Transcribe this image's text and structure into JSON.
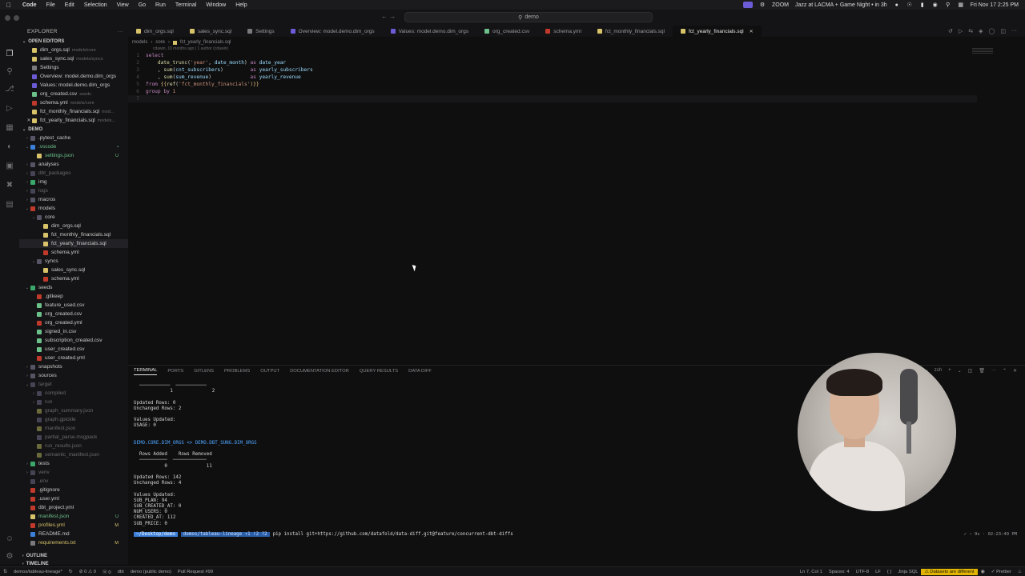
{
  "menubar": {
    "items": [
      "Code",
      "File",
      "Edit",
      "Selection",
      "View",
      "Go",
      "Run",
      "Terminal",
      "Window",
      "Help"
    ],
    "zoom_label": "ZOOM",
    "event": "Jazz at LACMA + Game Night • in 3h",
    "datetime": "Fri Nov 17  2:25 PM"
  },
  "titlebar": {
    "command_center": "demo"
  },
  "sidebar": {
    "title": "EXPLORER",
    "open_editors_label": "OPEN EDITORS",
    "open_editors": [
      {
        "name": "dim_orgs.sql",
        "desc": "models/core",
        "color": "#d8c36a"
      },
      {
        "name": "sales_sync.sql",
        "desc": "models/syncs",
        "color": "#d8c36a"
      },
      {
        "name": "Settings",
        "desc": "",
        "color": "#7a7a7e"
      },
      {
        "name": "Overview: model.demo.dim_orgs",
        "desc": "",
        "color": "#6b5bd6"
      },
      {
        "name": "Values: model.demo.dim_orgs",
        "desc": "",
        "color": "#6b5bd6"
      },
      {
        "name": "org_created.csv",
        "desc": "seeds",
        "color": "#6cc08a"
      },
      {
        "name": "schema.yml",
        "desc": "models/core",
        "color": "#c0392b"
      },
      {
        "name": "fct_monthly_financials.sql",
        "desc": "mod...",
        "color": "#d8c36a"
      },
      {
        "name": "fct_yearly_financials.sql",
        "desc": "models...",
        "color": "#d8c36a"
      }
    ],
    "project_label": "DEMO",
    "tree": [
      {
        "depth": 0,
        "chev": "›",
        "name": ".pytest_cache",
        "cls": "",
        "icon": "#556",
        "badge": ""
      },
      {
        "depth": 0,
        "chev": "⌄",
        "name": ".vscode",
        "cls": "c-green",
        "icon": "#3b7fd9",
        "badge": "•"
      },
      {
        "depth": 1,
        "chev": "",
        "name": "settings.json",
        "cls": "c-green",
        "icon": "#d8c36a",
        "badge": "U"
      },
      {
        "depth": 0,
        "chev": "›",
        "name": "analyses",
        "cls": "",
        "icon": "#556",
        "badge": ""
      },
      {
        "depth": 0,
        "chev": "›",
        "name": "dbt_packages",
        "cls": "c-dim",
        "icon": "#445",
        "badge": ""
      },
      {
        "depth": 0,
        "chev": "›",
        "name": "img",
        "cls": "",
        "icon": "#3aa86b",
        "badge": ""
      },
      {
        "depth": 0,
        "chev": "›",
        "name": "logs",
        "cls": "c-dim",
        "icon": "#445",
        "badge": ""
      },
      {
        "depth": 0,
        "chev": "›",
        "name": "macros",
        "cls": "",
        "icon": "#556",
        "badge": ""
      },
      {
        "depth": 0,
        "chev": "⌄",
        "name": "models",
        "cls": "",
        "icon": "#c0392b",
        "badge": ""
      },
      {
        "depth": 1,
        "chev": "⌄",
        "name": "core",
        "cls": "",
        "icon": "#556",
        "badge": ""
      },
      {
        "depth": 2,
        "chev": "",
        "name": "dim_orgs.sql",
        "cls": "",
        "icon": "#d8c36a",
        "badge": ""
      },
      {
        "depth": 2,
        "chev": "",
        "name": "fct_monthly_financials.sql",
        "cls": "",
        "icon": "#d8c36a",
        "badge": ""
      },
      {
        "depth": 2,
        "chev": "",
        "name": "fct_yearly_financials.sql",
        "cls": "",
        "icon": "#d8c36a",
        "badge": "",
        "sel": true
      },
      {
        "depth": 2,
        "chev": "",
        "name": "schema.yml",
        "cls": "",
        "icon": "#c0392b",
        "badge": ""
      },
      {
        "depth": 1,
        "chev": "⌄",
        "name": "syncs",
        "cls": "",
        "icon": "#556",
        "badge": ""
      },
      {
        "depth": 2,
        "chev": "",
        "name": "sales_sync.sql",
        "cls": "",
        "icon": "#d8c36a",
        "badge": ""
      },
      {
        "depth": 2,
        "chev": "",
        "name": "schema.yml",
        "cls": "",
        "icon": "#c0392b",
        "badge": ""
      },
      {
        "depth": 0,
        "chev": "⌄",
        "name": "seeds",
        "cls": "",
        "icon": "#3aa86b",
        "badge": ""
      },
      {
        "depth": 1,
        "chev": "",
        "name": ".gitkeep",
        "cls": "",
        "icon": "#c0392b",
        "badge": ""
      },
      {
        "depth": 1,
        "chev": "",
        "name": "feature_used.csv",
        "cls": "",
        "icon": "#6cc08a",
        "badge": ""
      },
      {
        "depth": 1,
        "chev": "",
        "name": "org_created.csv",
        "cls": "",
        "icon": "#6cc08a",
        "badge": ""
      },
      {
        "depth": 1,
        "chev": "",
        "name": "org_created.yml",
        "cls": "",
        "icon": "#c0392b",
        "badge": ""
      },
      {
        "depth": 1,
        "chev": "",
        "name": "signed_in.csv",
        "cls": "",
        "icon": "#6cc08a",
        "badge": ""
      },
      {
        "depth": 1,
        "chev": "",
        "name": "subscription_created.csv",
        "cls": "",
        "icon": "#6cc08a",
        "badge": ""
      },
      {
        "depth": 1,
        "chev": "",
        "name": "user_created.csv",
        "cls": "",
        "icon": "#6cc08a",
        "badge": ""
      },
      {
        "depth": 1,
        "chev": "",
        "name": "user_created.yml",
        "cls": "",
        "icon": "#c0392b",
        "badge": ""
      },
      {
        "depth": 0,
        "chev": "›",
        "name": "snapshots",
        "cls": "",
        "icon": "#556",
        "badge": ""
      },
      {
        "depth": 0,
        "chev": "›",
        "name": "sources",
        "cls": "",
        "icon": "#556",
        "badge": ""
      },
      {
        "depth": 0,
        "chev": "⌄",
        "name": "target",
        "cls": "c-dim",
        "icon": "#445",
        "badge": ""
      },
      {
        "depth": 1,
        "chev": "›",
        "name": "compiled",
        "cls": "c-dim",
        "icon": "#445",
        "badge": ""
      },
      {
        "depth": 1,
        "chev": "›",
        "name": "run",
        "cls": "c-dim",
        "icon": "#445",
        "badge": ""
      },
      {
        "depth": 1,
        "chev": "",
        "name": "graph_summary.json",
        "cls": "c-dim",
        "icon": "#6a6a3a",
        "badge": ""
      },
      {
        "depth": 1,
        "chev": "",
        "name": "graph.gpickle",
        "cls": "c-dim",
        "icon": "#445",
        "badge": ""
      },
      {
        "depth": 1,
        "chev": "",
        "name": "manifest.json",
        "cls": "c-dim",
        "icon": "#6a6a3a",
        "badge": ""
      },
      {
        "depth": 1,
        "chev": "",
        "name": "partial_parse.msgpack",
        "cls": "c-dim",
        "icon": "#445",
        "badge": ""
      },
      {
        "depth": 1,
        "chev": "",
        "name": "run_results.json",
        "cls": "c-dim",
        "icon": "#6a6a3a",
        "badge": ""
      },
      {
        "depth": 1,
        "chev": "",
        "name": "semantic_manifest.json",
        "cls": "c-dim",
        "icon": "#6a6a3a",
        "badge": ""
      },
      {
        "depth": 0,
        "chev": "›",
        "name": "tests",
        "cls": "",
        "icon": "#3aa86b",
        "badge": ""
      },
      {
        "depth": 0,
        "chev": "›",
        "name": "venv",
        "cls": "c-dim",
        "icon": "#445",
        "badge": ""
      },
      {
        "depth": 0,
        "chev": "",
        "name": ".env",
        "cls": "c-dim",
        "icon": "#445",
        "badge": ""
      },
      {
        "depth": 0,
        "chev": "",
        "name": ".gitignore",
        "cls": "",
        "icon": "#c0392b",
        "badge": ""
      },
      {
        "depth": 0,
        "chev": "",
        "name": ".user.yml",
        "cls": "",
        "icon": "#c0392b",
        "badge": ""
      },
      {
        "depth": 0,
        "chev": "",
        "name": "dbt_project.yml",
        "cls": "",
        "icon": "#c0392b",
        "badge": ""
      },
      {
        "depth": 0,
        "chev": "",
        "name": "manifest.json",
        "cls": "c-green",
        "icon": "#d8c36a",
        "badge": "U"
      },
      {
        "depth": 0,
        "chev": "",
        "name": "profiles.yml",
        "cls": "c-yellow",
        "icon": "#c0392b",
        "badge": "M"
      },
      {
        "depth": 0,
        "chev": "",
        "name": "README.md",
        "cls": "",
        "icon": "#3b7fd9",
        "badge": ""
      },
      {
        "depth": 0,
        "chev": "",
        "name": "requirements.txt",
        "cls": "c-yellow",
        "icon": "#7a7a7e",
        "badge": "M"
      }
    ],
    "outline_label": "OUTLINE",
    "timeline_label": "TIMELINE"
  },
  "tabs": [
    {
      "label": "dim_orgs.sql",
      "color": "#d8c36a",
      "active": false
    },
    {
      "label": "sales_sync.sql",
      "color": "#d8c36a",
      "active": false
    },
    {
      "label": "Settings",
      "color": "#7a7a7e",
      "active": false
    },
    {
      "label": "Overview: model.demo.dim_orgs",
      "color": "#6b5bd6",
      "active": false
    },
    {
      "label": "Values: model.demo.dim_orgs",
      "color": "#6b5bd6",
      "active": false
    },
    {
      "label": "org_created.csv",
      "color": "#6cc08a",
      "active": false
    },
    {
      "label": "schema.yml",
      "color": "#c0392b",
      "active": false
    },
    {
      "label": "fct_monthly_financials.sql",
      "color": "#d8c36a",
      "active": false
    },
    {
      "label": "fct_yearly_financials.sql",
      "color": "#d8c36a",
      "active": true
    }
  ],
  "breadcrumb": [
    "models",
    "core",
    "fct_yearly_financials.sql"
  ],
  "blame": "cdawin, 10 months ago | 1 author (cdawin)",
  "code_lines": [
    [
      {
        "t": "select",
        "c": "kw"
      }
    ],
    [
      {
        "t": "    ",
        "c": "pl"
      },
      {
        "t": "date_trunc",
        "c": "fn"
      },
      {
        "t": "(",
        "c": "pl"
      },
      {
        "t": "'year'",
        "c": "str"
      },
      {
        "t": ", ",
        "c": "pl"
      },
      {
        "t": "date_month",
        "c": "id"
      },
      {
        "t": ") ",
        "c": "pl"
      },
      {
        "t": "as",
        "c": "kw"
      },
      {
        "t": " date_year",
        "c": "id"
      }
    ],
    [
      {
        "t": "    , ",
        "c": "pl"
      },
      {
        "t": "sum",
        "c": "fn"
      },
      {
        "t": "(",
        "c": "pl"
      },
      {
        "t": "cnt_subscribers",
        "c": "id"
      },
      {
        "t": ")         ",
        "c": "pl"
      },
      {
        "t": "as",
        "c": "kw"
      },
      {
        "t": " yearly_subscribers",
        "c": "id"
      }
    ],
    [
      {
        "t": "    , ",
        "c": "pl"
      },
      {
        "t": "sum",
        "c": "fn"
      },
      {
        "t": "(",
        "c": "pl"
      },
      {
        "t": "sum_revenue",
        "c": "id"
      },
      {
        "t": ")             ",
        "c": "pl"
      },
      {
        "t": "as",
        "c": "kw"
      },
      {
        "t": " yearly_revenue",
        "c": "id"
      }
    ],
    [
      {
        "t": "from",
        "c": "kw"
      },
      {
        "t": " {{",
        "c": "jin"
      },
      {
        "t": "ref",
        "c": "fn"
      },
      {
        "t": "(",
        "c": "pl"
      },
      {
        "t": "'fct_monthly_financials'",
        "c": "str"
      },
      {
        "t": ")}}",
        "c": "jin"
      }
    ],
    [
      {
        "t": "group by",
        "c": "kw"
      },
      {
        "t": " 1",
        "c": "str"
      }
    ],
    [
      {
        "t": "",
        "c": "pl"
      }
    ]
  ],
  "panel": {
    "tabs": [
      "TERMINAL",
      "PORTS",
      "GITLENS",
      "PROBLEMS",
      "OUTPUT",
      "DOCUMENTATION EDITOR",
      "QUERY RESULTS",
      "DATA DIFF"
    ],
    "shell_label": "zsh",
    "terminal_lines": [
      {
        "t": "  ───────────  ───────────",
        "c": ""
      },
      {
        "t": "             1              2",
        "c": ""
      },
      {
        "t": "",
        "c": ""
      },
      {
        "t": "Updated Rows: 0",
        "c": ""
      },
      {
        "t": "Unchanged Rows: 2",
        "c": ""
      },
      {
        "t": "",
        "c": ""
      },
      {
        "t": "Values Updated:",
        "c": ""
      },
      {
        "t": "USAGE: 0",
        "c": ""
      },
      {
        "t": "",
        "c": ""
      },
      {
        "t": "",
        "c": ""
      },
      {
        "t": "DEMO.CORE.DIM_ORGS <> DEMO.DBT_SUNG.DIM_ORGS",
        "c": "t-blue"
      },
      {
        "t": "",
        "c": ""
      },
      {
        "t": "  Rows Added    Rows Removed",
        "c": ""
      },
      {
        "t": "  ──────────  ────────────",
        "c": ""
      },
      {
        "t": "           0              11",
        "c": ""
      },
      {
        "t": "",
        "c": ""
      },
      {
        "t": "Updated Rows: 142",
        "c": ""
      },
      {
        "t": "Unchanged Rows: 4",
        "c": ""
      },
      {
        "t": "",
        "c": ""
      },
      {
        "t": "Values Updated:",
        "c": ""
      },
      {
        "t": "SUB_PLAN: 94",
        "c": ""
      },
      {
        "t": "SUB_CREATED_AT: 0",
        "c": ""
      },
      {
        "t": "NUM_USERS: 0",
        "c": ""
      },
      {
        "t": "CREATED_AT: 112",
        "c": ""
      },
      {
        "t": "SUB_PRICE: 0",
        "c": ""
      }
    ],
    "prompt_dir": "~/Desktop/demo",
    "prompt_git": "demos/tableau-lineage ↑1 !2 ?2",
    "prompt_cmd": "pip install git+https://github.com/datafold/data-diff.git@feature/concurrent-dbt-diffs",
    "rprompt": "✓ ‹ 9s · 02:23:49 PM"
  },
  "statusbar": {
    "branch": "demos/tableau-lineage*",
    "errors": "⊘ 0 ⚠ 0",
    "ports": "ⓦ 0",
    "dbt": "dbt",
    "project": "demo (public demo)",
    "pr": "Pull Request #99",
    "position": "Ln 7, Col 1",
    "spaces": "Spaces: 4",
    "encoding": "UTF-8",
    "eol": "LF",
    "language": "Jinja SQL",
    "warning": "⚠ Datasets are different",
    "prettier": "✓ Prettier"
  }
}
